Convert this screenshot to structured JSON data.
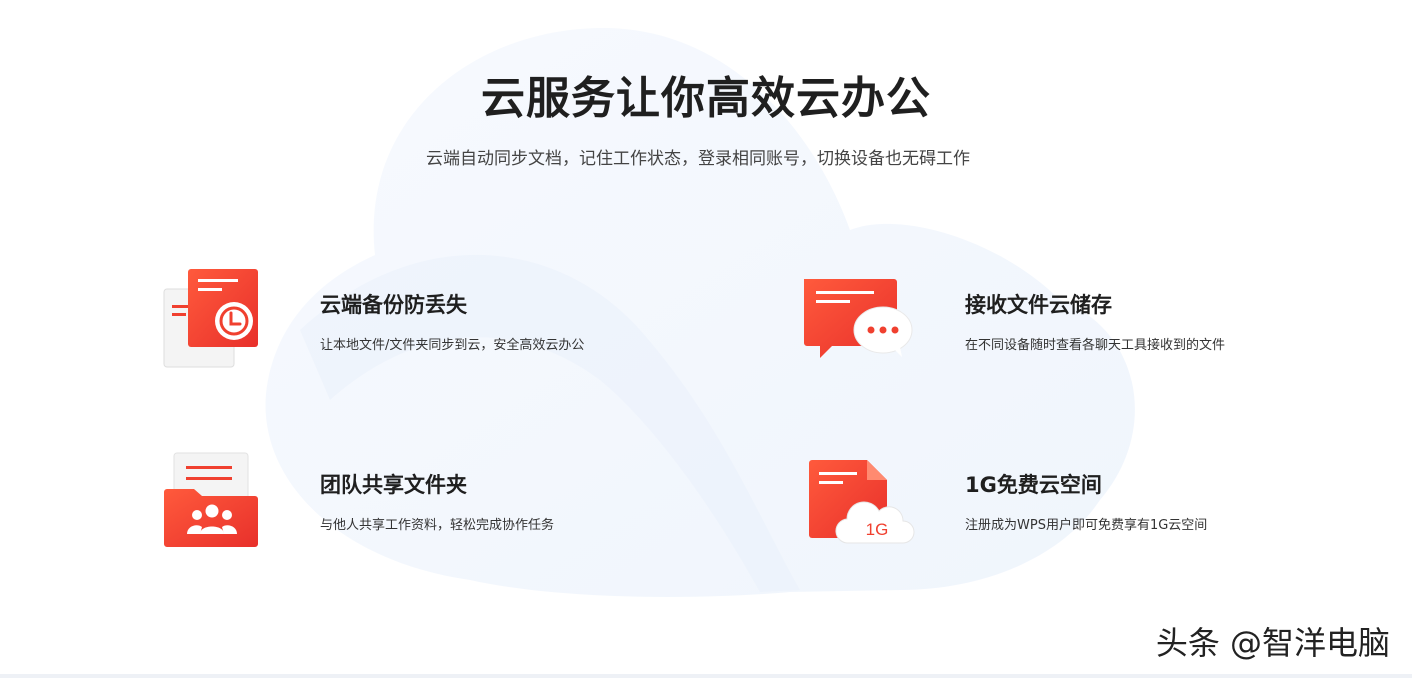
{
  "header": {
    "title": "云服务让你高效云办公",
    "subtitle": "云端自动同步文档，记住工作状态，登录相同账号，切换设备也无碍工作"
  },
  "features": [
    {
      "title": "云端备份防丢失",
      "description": "让本地文件/文件夹同步到云，安全高效云办公",
      "icon": "backup-folder-clock-icon"
    },
    {
      "title": "接收文件云储存",
      "description": "在不同设备随时查看各聊天工具接收到的文件",
      "icon": "chat-bubble-icon"
    },
    {
      "title": "团队共享文件夹",
      "description": "与他人共享工作资料，轻松完成协作任务",
      "icon": "shared-folder-team-icon"
    },
    {
      "title": "1G免费云空间",
      "description": "注册成为WPS用户即可免费享有1G云空间",
      "icon": "cloud-storage-1g-icon",
      "badge": "1G"
    }
  ],
  "watermark": "头条 @智洋电脑",
  "colors": {
    "accent": "#f0402f",
    "accent_light": "#ff6a4d",
    "background_cloud": "#f3f7fd"
  }
}
